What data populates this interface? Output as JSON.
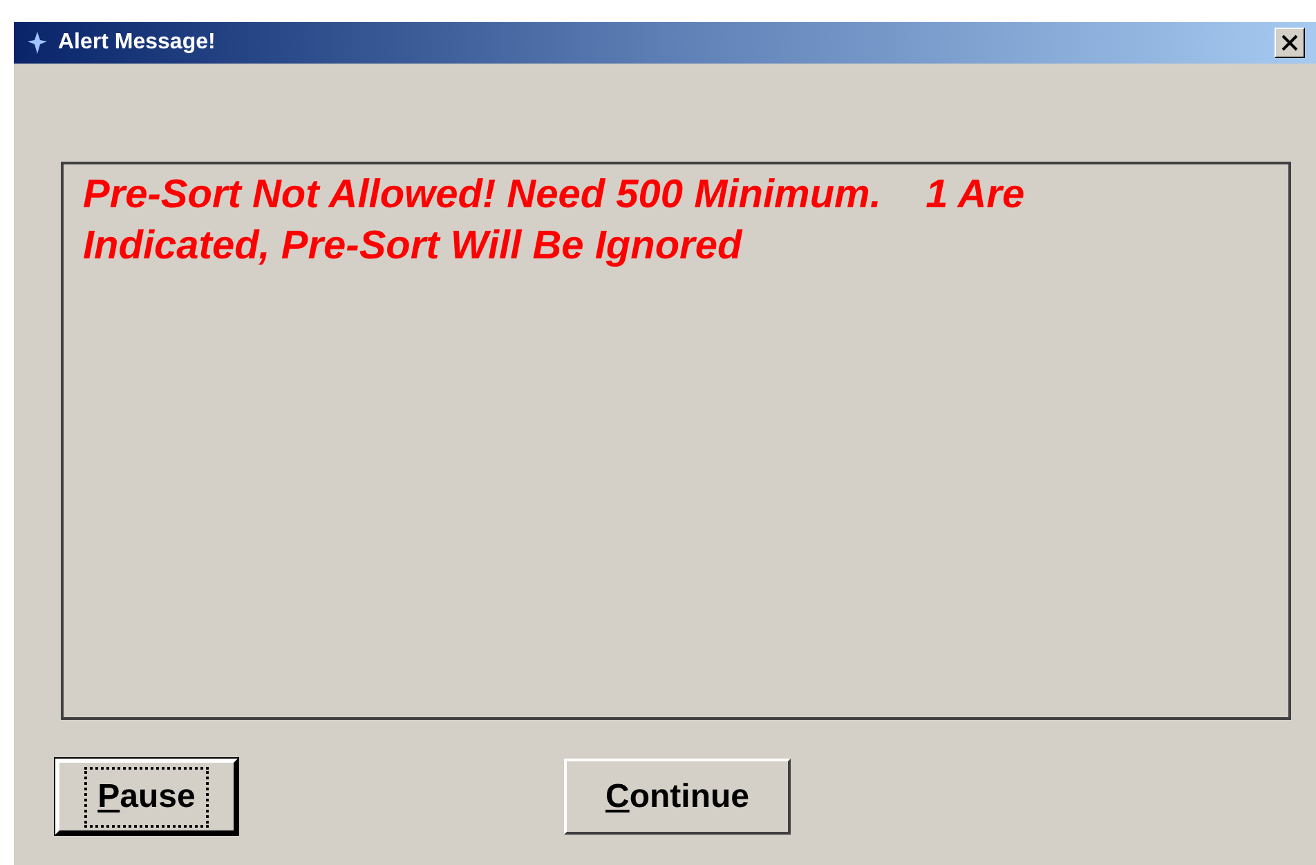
{
  "window": {
    "title": "Alert Message!"
  },
  "message": "Pre-Sort Not Allowed! Need 500 Minimum.    1 Are Indicated, Pre-Sort Will Be Ignored",
  "buttons": [
    {
      "label": "Pause",
      "focused": true
    },
    {
      "label": "Continue",
      "focused": false
    }
  ]
}
